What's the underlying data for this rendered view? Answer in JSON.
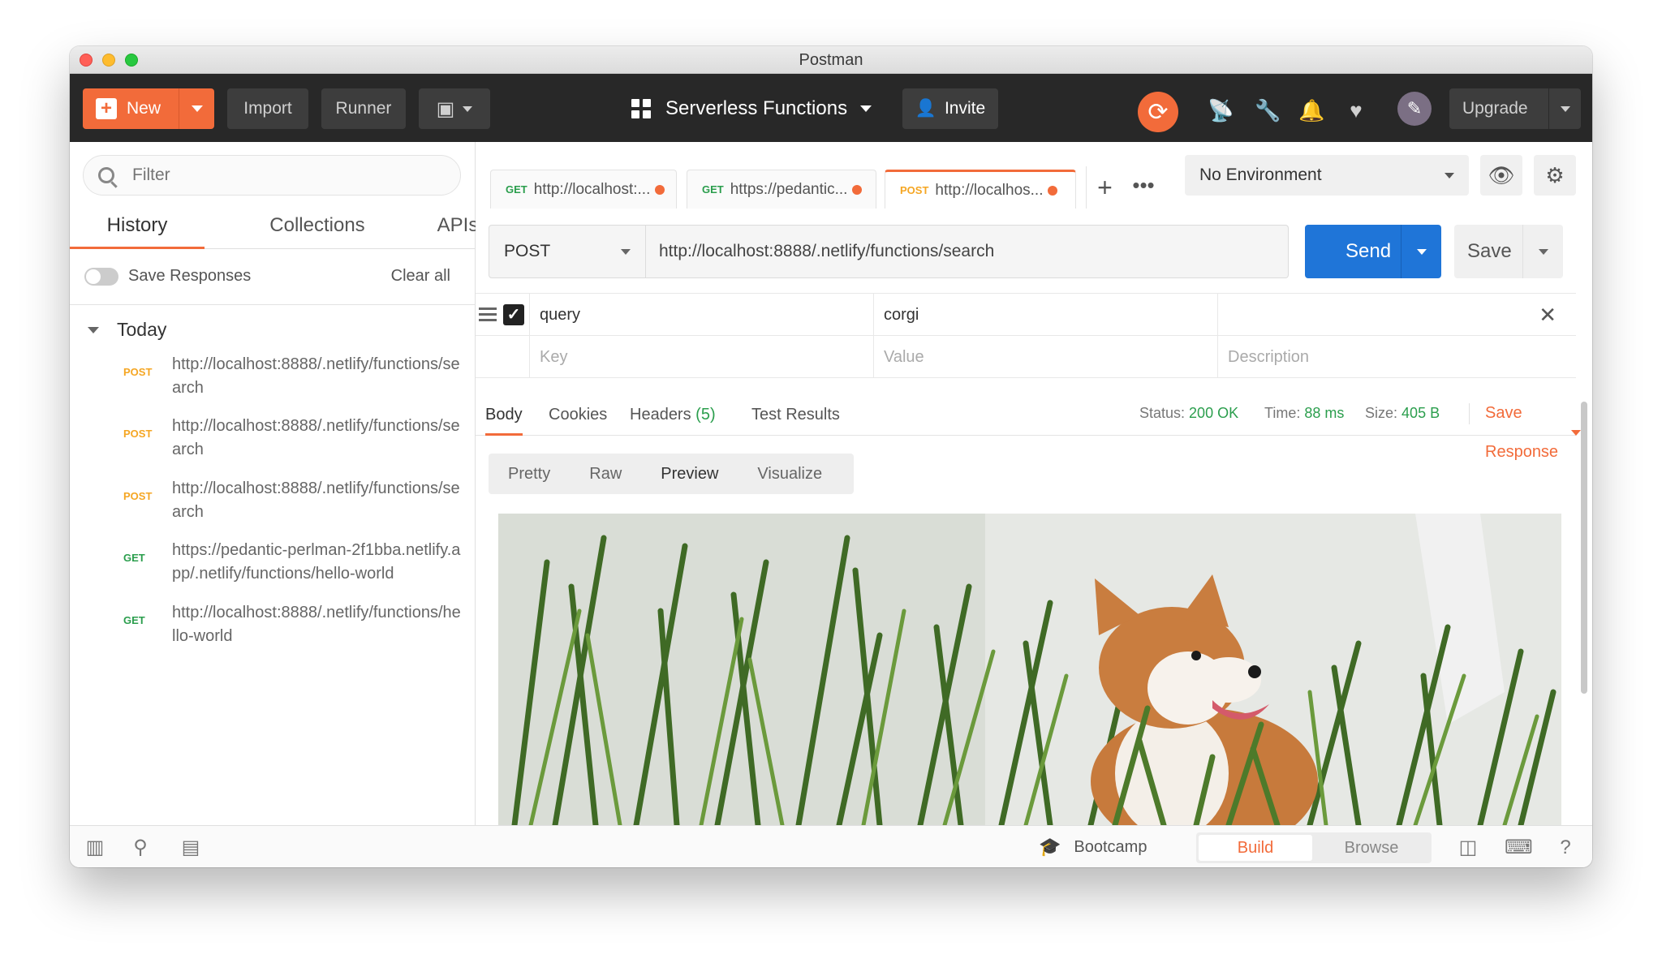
{
  "window": {
    "title": "Postman"
  },
  "header": {
    "new_label": "New",
    "import_label": "Import",
    "runner_label": "Runner",
    "workspace": "Serverless Functions",
    "invite_label": "Invite",
    "upgrade_label": "Upgrade",
    "accent": "#f26b3a"
  },
  "sidebar": {
    "filter_placeholder": "Filter",
    "tabs": [
      "History",
      "Collections",
      "APIs"
    ],
    "save_responses_label": "Save Responses",
    "clear_all_label": "Clear all",
    "group_label": "Today",
    "history": [
      {
        "method": "POST",
        "url": "http://localhost:8888/.netlify/functions/search"
      },
      {
        "method": "POST",
        "url": "http://localhost:8888/.netlify/functions/search"
      },
      {
        "method": "POST",
        "url": "http://localhost:8888/.netlify/functions/search"
      },
      {
        "method": "GET",
        "url": "https://pedantic-perlman-2f1bba.netlify.app/.netlify/functions/hello-world"
      },
      {
        "method": "GET",
        "url": "http://localhost:8888/.netlify/functions/hello-world"
      }
    ]
  },
  "tabs": [
    {
      "method": "GET",
      "label": "http://localhost:..."
    },
    {
      "method": "GET",
      "label": "https://pedantic..."
    },
    {
      "method": "POST",
      "label": "http://localhos..."
    }
  ],
  "environment": {
    "selected": "No Environment"
  },
  "request": {
    "method": "POST",
    "url": "http://localhost:8888/.netlify/functions/search",
    "send_label": "Send",
    "save_label": "Save"
  },
  "params": {
    "row": {
      "key": "query",
      "value": "corgi"
    },
    "placeholders": {
      "key": "Key",
      "value": "Value",
      "description": "Description"
    }
  },
  "response": {
    "tabs": {
      "body": "Body",
      "cookies": "Cookies",
      "headers": "Headers",
      "headers_count": "(5)",
      "tests": "Test Results"
    },
    "status_label": "Status:",
    "status_value": "200 OK",
    "time_label": "Time:",
    "time_value": "88 ms",
    "size_label": "Size:",
    "size_value": "405 B",
    "save_response_label": "Save Response",
    "views": [
      "Pretty",
      "Raw",
      "Preview",
      "Visualize"
    ]
  },
  "footer": {
    "bootcamp_label": "Bootcamp",
    "build_label": "Build",
    "browse_label": "Browse"
  }
}
